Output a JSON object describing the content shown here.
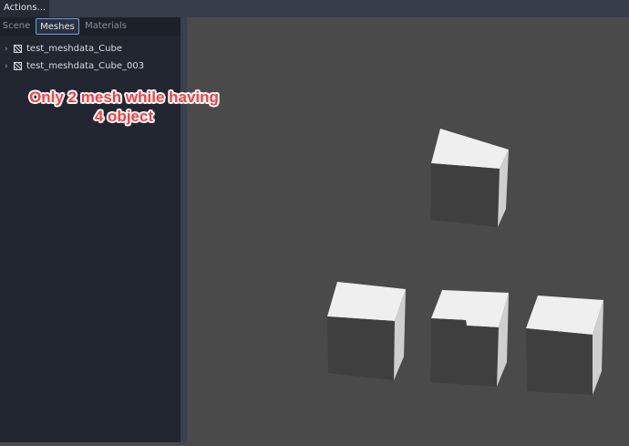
{
  "toolbar": {
    "actions_label": "Actions..."
  },
  "tabs": [
    {
      "label": "Scene",
      "active": false
    },
    {
      "label": "Meshes",
      "active": true
    },
    {
      "label": "Materials",
      "active": false
    }
  ],
  "tree": {
    "items": [
      {
        "label": "test_meshdata_Cube",
        "icon": "mesh-icon",
        "expander": "chevron-right-icon"
      },
      {
        "label": "test_meshdata_Cube_003",
        "icon": "mesh-icon",
        "expander": "chevron-right-icon"
      }
    ]
  },
  "annotation": {
    "line1": "Only 2 mesh while having",
    "line2": "4 object",
    "color": "#ff3b3b"
  },
  "viewport": {
    "background": "#4a4a4a",
    "objects": [
      "cube",
      "cube",
      "cube",
      "cube"
    ]
  }
}
